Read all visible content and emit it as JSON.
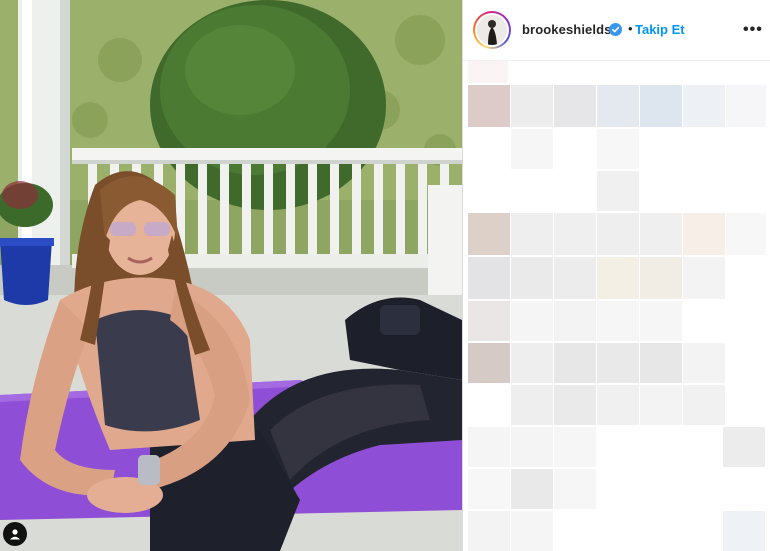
{
  "post": {
    "username": "brookeshields",
    "follow_label": "Takip Et",
    "separator": "•",
    "more_icon": "more-options-icon",
    "verified_icon": "verified-badge-icon"
  },
  "colors": {
    "accent": "#0095f6",
    "text": "#262626",
    "border": "#dbdbdb",
    "verified": "#3897f0",
    "mat": "#8e4fd6"
  }
}
